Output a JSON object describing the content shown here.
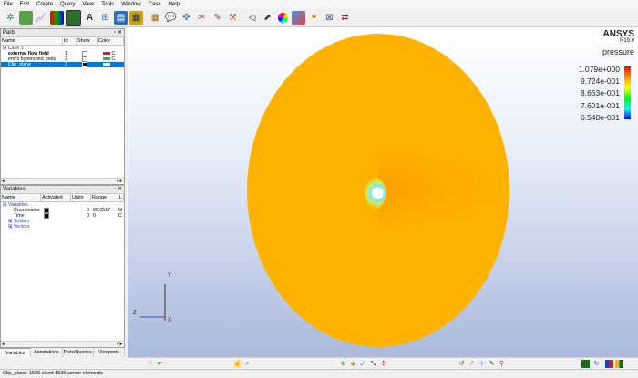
{
  "menu": [
    "File",
    "Edit",
    "Create",
    "Query",
    "View",
    "Tools",
    "Window",
    "Case",
    "Help"
  ],
  "toolbar": {
    "icons": [
      "part-icon",
      "annotation-icon",
      "plot-icon",
      "legend-icon",
      "viewport-icon",
      "font-icon",
      "frame-icon",
      "notes-icon",
      "calculator-icon",
      "cases-icon",
      "query-icon",
      "probe-icon",
      "cut-icon",
      "palette-icon",
      "measure-icon",
      "select-icon",
      "pointer-icon",
      "color-wheel-icon",
      "texture-icon",
      "lighting-icon",
      "grid-icon",
      "transform-icon"
    ]
  },
  "parts": {
    "title": "Parts",
    "columns": [
      "Name",
      "Id",
      "Show",
      "Color"
    ],
    "case_label": "Case 1",
    "rows": [
      {
        "name": "external flow field",
        "id": "1",
        "color": "#e02020"
      },
      {
        "name": "emi's hypersonic body",
        "id": "2",
        "color": "#40b040"
      },
      {
        "name": "Clip_plane",
        "id": "3",
        "color": "#ffffff"
      }
    ]
  },
  "variables": {
    "title": "Variables",
    "columns": [
      "Name",
      "Activated",
      "Units",
      "Range",
      "L"
    ],
    "root": "Variables",
    "rows": [
      {
        "name": "Coordinates",
        "units": "0",
        "range": "86.0517",
        "extra": "M"
      },
      {
        "name": "Time",
        "units": "0",
        "range": "0",
        "extra": "C"
      }
    ],
    "groups": [
      "Scalars",
      "Vectors"
    ]
  },
  "bottom_tabs": [
    "Variables",
    "Annotations",
    "Plots/Queries",
    "Viewports"
  ],
  "viewport": {
    "brand": "ANSYS",
    "version": "R19.0",
    "legend_title": "pressure",
    "legend_values": [
      "1.079e+000",
      "9.724e-001",
      "8.663e-001",
      "7.601e-001",
      "6.540e-001"
    ],
    "axis_y": "Y",
    "axis_z": "Z",
    "axis_x": "X"
  },
  "status": "Clip_plane: 1536 client 1536 server elements"
}
